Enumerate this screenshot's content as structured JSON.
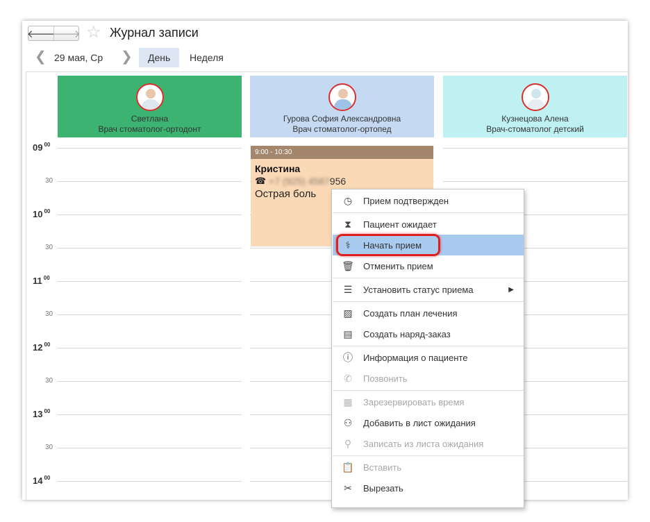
{
  "header": {
    "title": "Журнал записи",
    "back_icon": "arrow-left-icon",
    "forward_icon": "arrow-right-icon",
    "favorite_icon": "star-icon"
  },
  "datebar": {
    "date": "29 мая, Ср",
    "tab_day": "День",
    "tab_week": "Неделя",
    "active_tab": "День"
  },
  "doctors": [
    {
      "name": "Светлана",
      "role": "Врач стоматолог-ортодонт",
      "color": "#3cb371"
    },
    {
      "name": "Гурова София Александровна",
      "role": "Врач стоматолог-ортопед",
      "color": "#c5d9f3"
    },
    {
      "name": "Кузнецова Алена",
      "role": "Врач-стоматолог детский",
      "color": "#bff0f2"
    }
  ],
  "timeline": {
    "hours": [
      "09",
      "10",
      "11",
      "12",
      "13",
      "14"
    ],
    "minutes_top": "00",
    "half": "30"
  },
  "appointment": {
    "time": "9:00 - 10:30",
    "patient": "Кристина",
    "phone_visible_end": "956",
    "phone_blurred": "+7 (925) 4587",
    "note": "Острая боль",
    "header_color": "#a3866b",
    "body_color": "#fbd9b7"
  },
  "context_menu": {
    "items": [
      {
        "label": "Прием подтвержден",
        "icon": "check-circle-icon",
        "enabled": true
      },
      {
        "label": "Пациент ожидает",
        "icon": "hourglass-icon",
        "enabled": true
      },
      {
        "label": "Начать прием",
        "icon": "stethoscope-icon",
        "enabled": true,
        "highlighted": true
      },
      {
        "label": "Отменить прием",
        "icon": "trash-icon",
        "enabled": true
      },
      {
        "label": "Установить статус приема",
        "icon": "list-icon",
        "enabled": true,
        "submenu": true
      },
      {
        "label": "Создать план лечения",
        "icon": "chart-doc-icon",
        "enabled": true
      },
      {
        "label": "Создать наряд-заказ",
        "icon": "order-doc-icon",
        "enabled": true
      },
      {
        "label": "Информация о пациенте",
        "icon": "info-icon",
        "enabled": true
      },
      {
        "label": "Позвонить",
        "icon": "phone-icon",
        "enabled": false
      },
      {
        "label": "Зарезервировать время",
        "icon": "calendar-icon",
        "enabled": false
      },
      {
        "label": "Добавить в лист ожидания",
        "icon": "person-clock-icon",
        "enabled": true
      },
      {
        "label": "Записать из листа ожидания",
        "icon": "person-key-icon",
        "enabled": false
      },
      {
        "label": "Вставить",
        "icon": "clipboard-icon",
        "enabled": false
      },
      {
        "label": "Вырезать",
        "icon": "scissors-icon",
        "enabled": true
      }
    ],
    "highlight_color": "#a9cbf0",
    "annotation_color": "#e02020"
  }
}
